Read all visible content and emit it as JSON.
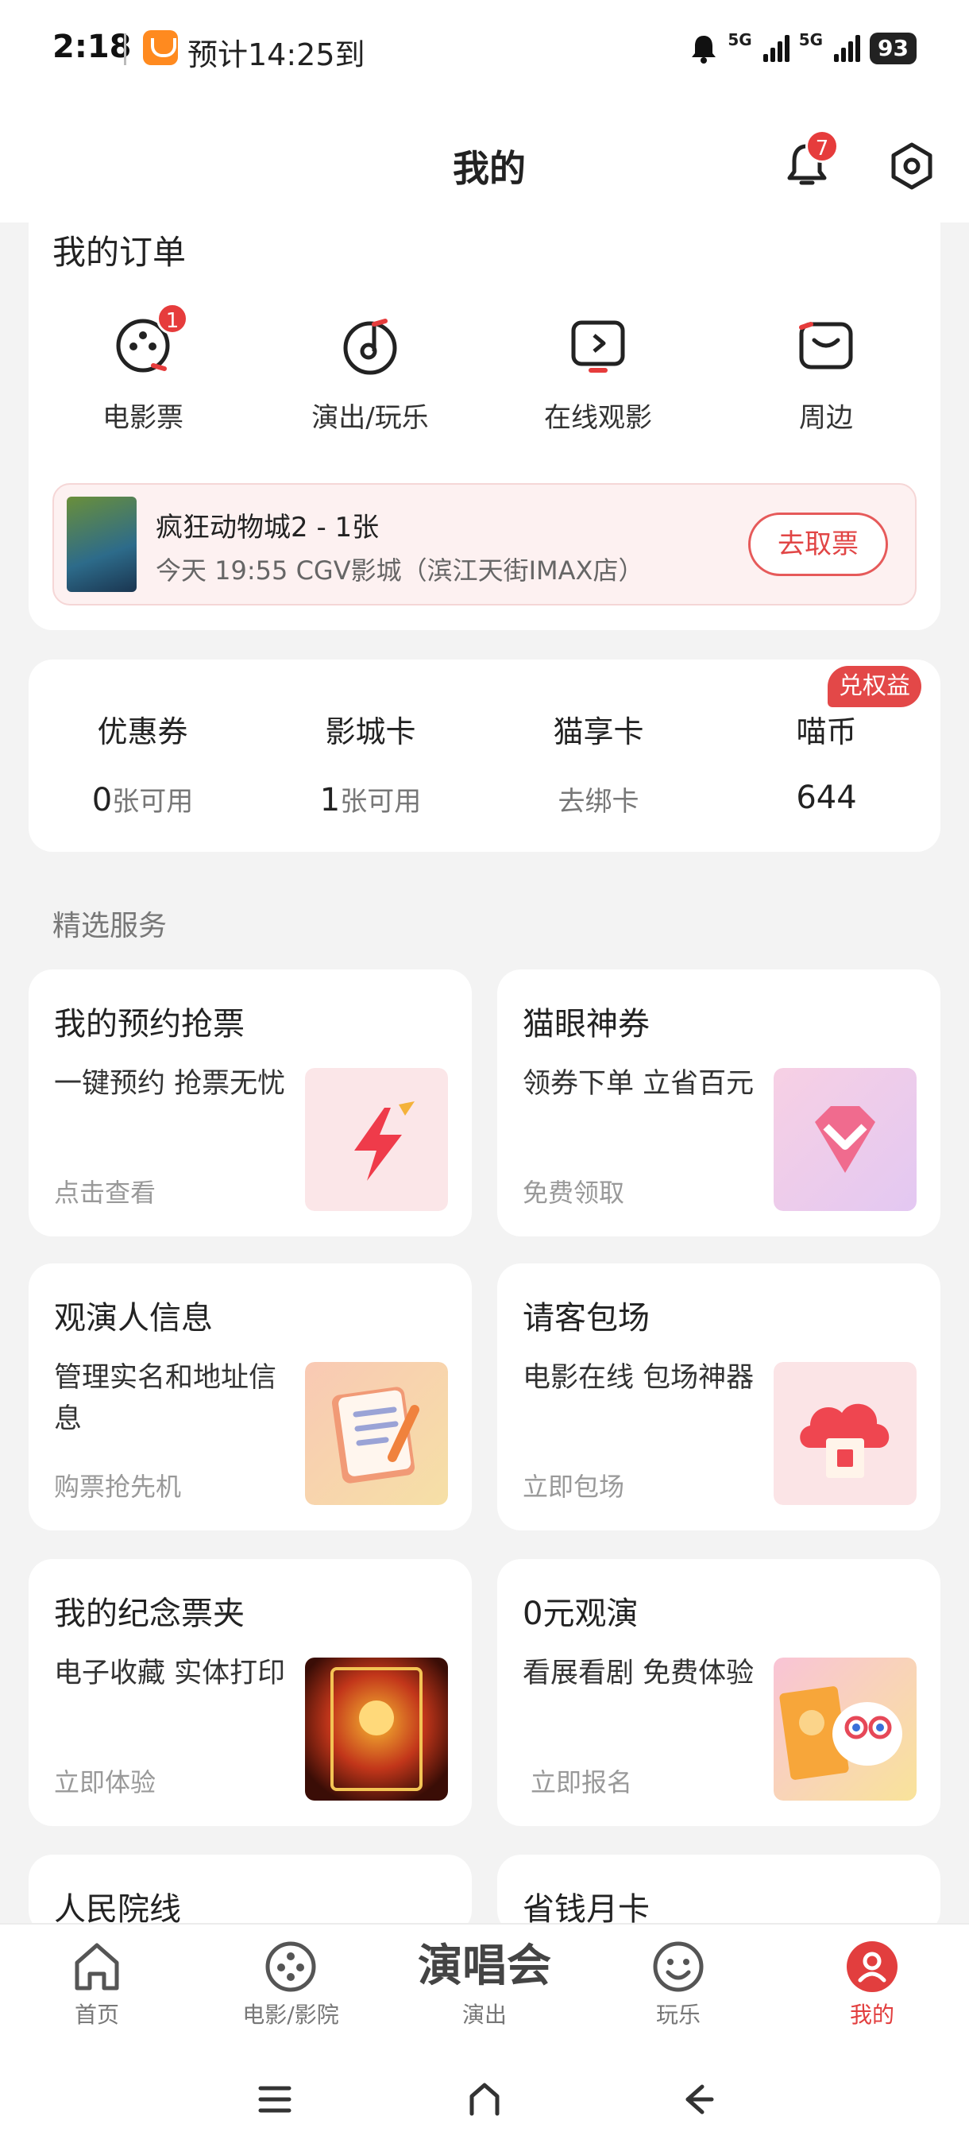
{
  "status_bar": {
    "time": "2:18",
    "eta": "预计14:25到",
    "network_1": "5G",
    "network_2": "5G",
    "battery": "93"
  },
  "header": {
    "title": "我的",
    "notification_count": "7"
  },
  "orders": {
    "title": "我的订单",
    "items": [
      {
        "label": "电影票",
        "badge": "1",
        "icon": "film-reel-icon"
      },
      {
        "label": "演出/玩乐",
        "icon": "music-note-icon"
      },
      {
        "label": "在线观影",
        "icon": "play-screen-icon"
      },
      {
        "label": "周边",
        "icon": "bag-icon"
      }
    ],
    "ticket": {
      "title": "疯狂动物城2 - 1张",
      "subtitle": "今天 19:55 CGV影城（滨江天街IMAX店）",
      "button": "去取票"
    }
  },
  "wallet": {
    "badge": "兑权益",
    "items": [
      {
        "label": "优惠券",
        "value_num": "0",
        "value_suffix": "张可用"
      },
      {
        "label": "影城卡",
        "value_num": "1",
        "value_suffix": "张可用"
      },
      {
        "label": "猫享卡",
        "value_num": "",
        "value_suffix": "去绑卡"
      },
      {
        "label": "喵币",
        "value_num": "644",
        "value_suffix": ""
      }
    ]
  },
  "services": {
    "title": "精选服务",
    "items": [
      {
        "title": "我的预约抢票",
        "desc": "一键预约 抢票无忧",
        "cta": "点击查看",
        "icon": "lightning-icon"
      },
      {
        "title": "猫眼神券",
        "desc": "领券下单 立省百元",
        "cta": "免费领取",
        "icon": "diamond-coupon-icon"
      },
      {
        "title": "观演人信息",
        "desc": "管理实名和地址信息",
        "cta": "购票抢先机",
        "icon": "clipboard-icon"
      },
      {
        "title": "请客包场",
        "desc": "电影在线 包场神器",
        "cta": "立即包场",
        "icon": "cloud-ticket-icon"
      },
      {
        "title": "我的纪念票夹",
        "desc": "电子收藏 实体打印",
        "cta": "立即体验",
        "icon": "souvenir-ticket-icon"
      },
      {
        "title": "0元观演",
        "desc": "看展看剧 免费体验",
        "cta": "立即报名",
        "icon": "free-ticket-cat-icon"
      },
      {
        "title": "人民院线"
      },
      {
        "title": "省钱月卡"
      }
    ]
  },
  "tabbar": {
    "items": [
      {
        "label": "首页",
        "icon": "home-icon"
      },
      {
        "label": "电影/影院",
        "icon": "film-reel-icon"
      },
      {
        "big": "演唱会",
        "label": "演出"
      },
      {
        "label": "玩乐",
        "icon": "smile-icon"
      },
      {
        "label": "我的",
        "icon": "profile-icon",
        "active": true
      }
    ]
  },
  "colors": {
    "accent": "#e63c3c",
    "background": "#f3f3f3"
  }
}
